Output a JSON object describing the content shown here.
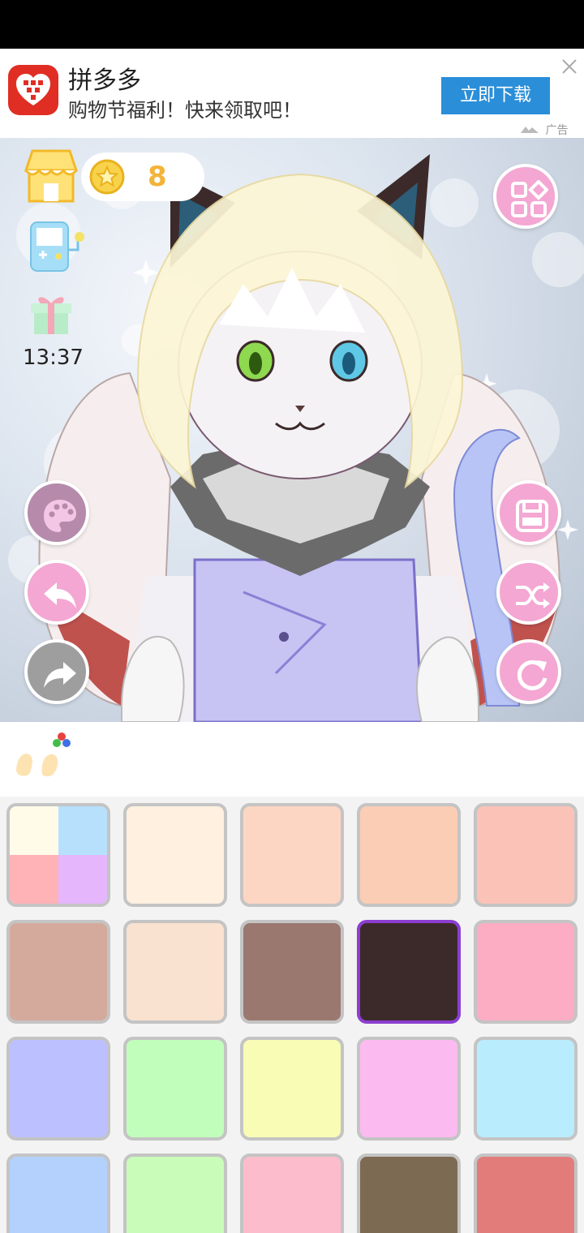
{
  "ad": {
    "title": "拼多多",
    "subtitle": "购物节福利！快来领取吧！",
    "button_label": "立即下载",
    "tag": "广告",
    "logo_color": "#e02e24",
    "button_color": "#2a8ed8"
  },
  "hud": {
    "coins": "8",
    "time": "13:37"
  },
  "icons": {
    "shop": "shop-icon",
    "coin": "star-coin-icon",
    "gameboy": "gameboy-icon",
    "gift": "gift-icon",
    "palette": "palette-icon",
    "undo": "undo-arrow-icon",
    "redo": "redo-arrow-icon",
    "menu": "grid-menu-icon",
    "save": "save-icon",
    "shuffle": "shuffle-icon",
    "reset": "reset-icon",
    "category": "ears-color-icon",
    "ad_close": "close-icon"
  },
  "colors": {
    "accent_pink": "#f4a7d3",
    "selected_border": "#8c3ed1",
    "coin_text": "#f3b43a"
  },
  "swatches": [
    {
      "type": "multi",
      "colors": [
        "#fffbe8",
        "#b6e0fb",
        "#ffb3b6",
        "#e5b6fb"
      ]
    },
    {
      "color": "#fff0e0"
    },
    {
      "color": "#fdd6c3"
    },
    {
      "color": "#fbcdb5"
    },
    {
      "color": "#fbc3b8"
    },
    {
      "color": "#d4aa9d"
    },
    {
      "color": "#f9e2cf"
    },
    {
      "color": "#9a7870"
    },
    {
      "color": "#3c2a2a",
      "selected": true
    },
    {
      "color": "#fcacc3"
    },
    {
      "color": "#bcc0ff"
    },
    {
      "color": "#c1fdbb"
    },
    {
      "color": "#f8fcb4"
    },
    {
      "color": "#fbbaf0"
    },
    {
      "color": "#b9ecfc"
    },
    {
      "color": "#b3d1fc"
    },
    {
      "color": "#c9fcb9"
    },
    {
      "color": "#fdbccb"
    },
    {
      "color": "#7d6a52"
    },
    {
      "color": "#e27c7b"
    }
  ]
}
